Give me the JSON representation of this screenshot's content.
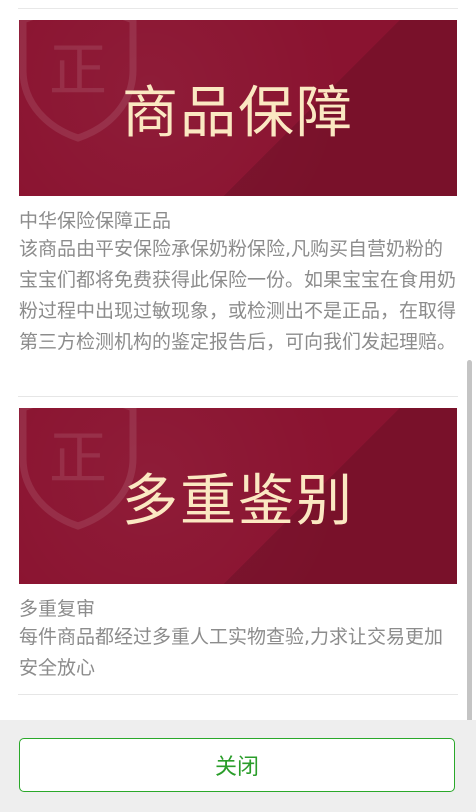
{
  "sections": [
    {
      "banner_text": "商品保障",
      "title": "中华保险保障正品",
      "body": "该商品由平安保险承保奶粉保险,凡购买自营奶粉的宝宝们都将免费获得此保险一份。如果宝宝在食用奶粉过程中出现过敏现象，或检测出不是正品，在取得第三方检测机构的鉴定报告后，可向我们发起理赔。"
    },
    {
      "banner_text": "多重鉴别",
      "title": "多重复审",
      "body": "每件商品都经过多重人工实物查验,力求让交易更加安全放心"
    }
  ],
  "footer": {
    "close_label": "关闭"
  },
  "colors": {
    "banner_bg": "#8a1330",
    "banner_text": "#fbe8c2",
    "accent_green": "#2a9d2a",
    "text_gray": "#8c8c8c"
  }
}
